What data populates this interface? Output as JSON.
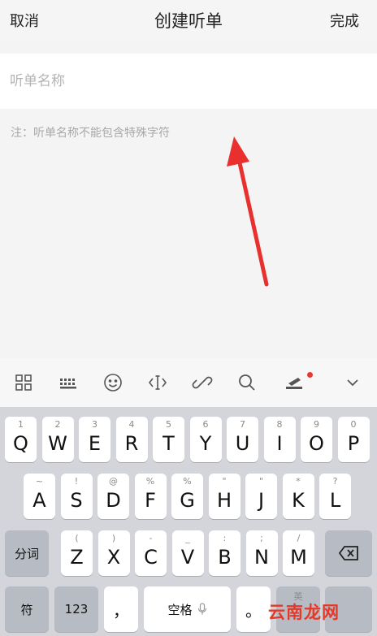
{
  "header": {
    "cancel": "取消",
    "title": "创建听单",
    "done": "完成"
  },
  "form": {
    "name_placeholder": "听单名称",
    "name_value": "",
    "note": "注：听单名称不能包含特殊字符"
  },
  "annotation": {
    "color": "#e8302e"
  },
  "toolbar": {
    "icons": [
      "grid-icon",
      "keyboard-switch-icon",
      "emoji-icon",
      "cursor-icon",
      "link-icon",
      "search-icon",
      "stamp-icon",
      "chevron-down-icon"
    ]
  },
  "keyboard": {
    "row1": [
      {
        "hint": "1",
        "key": "Q"
      },
      {
        "hint": "2",
        "key": "W"
      },
      {
        "hint": "3",
        "key": "E"
      },
      {
        "hint": "4",
        "key": "R"
      },
      {
        "hint": "5",
        "key": "T"
      },
      {
        "hint": "6",
        "key": "Y"
      },
      {
        "hint": "7",
        "key": "U"
      },
      {
        "hint": "8",
        "key": "I"
      },
      {
        "hint": "9",
        "key": "O"
      },
      {
        "hint": "0",
        "key": "P"
      }
    ],
    "row2": [
      {
        "hint": "~",
        "key": "A"
      },
      {
        "hint": "!",
        "key": "S"
      },
      {
        "hint": "@",
        "key": "D"
      },
      {
        "hint": "%",
        "key": "F"
      },
      {
        "hint": "%",
        "key": "G"
      },
      {
        "hint": "\"",
        "key": "H"
      },
      {
        "hint": "\"",
        "key": "J"
      },
      {
        "hint": "*",
        "key": "K"
      },
      {
        "hint": "?",
        "key": "L"
      }
    ],
    "row3": [
      {
        "hint": "(",
        "key": "Z"
      },
      {
        "hint": ")",
        "key": "X"
      },
      {
        "hint": "-",
        "key": "C"
      },
      {
        "hint": "_",
        "key": "V"
      },
      {
        "hint": ":",
        "key": "B"
      },
      {
        "hint": ";",
        "key": "N"
      },
      {
        "hint": "/",
        "key": "M"
      }
    ],
    "segment": "分词",
    "symbol": "符",
    "numbers": "123",
    "comma": "，",
    "space": "空格",
    "period": "。",
    "enter_hint": "英"
  },
  "watermark": "云南龙网"
}
